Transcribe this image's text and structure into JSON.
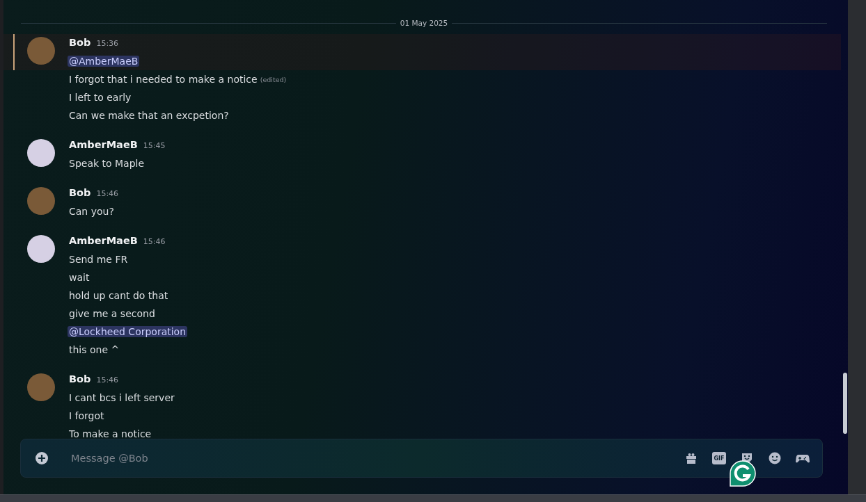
{
  "date_divider": "01 May 2025",
  "messages": [
    {
      "author": "Bob",
      "time": "15:36",
      "avatar": {
        "color": "#7a5a38"
      },
      "highlighted": true,
      "lines": [
        {
          "kind": "mention",
          "text": "@AmberMaeB"
        },
        {
          "kind": "text",
          "text": "I forgot that i needed to make a notice",
          "edited": "(edited)"
        },
        {
          "kind": "text",
          "text": "I left to early"
        },
        {
          "kind": "text",
          "text": "Can we make that an excpetion?"
        }
      ]
    },
    {
      "author": "AmberMaeB",
      "time": "15:45",
      "avatar": {
        "color": "#d6d0e4"
      },
      "highlighted": false,
      "lines": [
        {
          "kind": "text",
          "text": "Speak to Maple"
        }
      ]
    },
    {
      "author": "Bob",
      "time": "15:46",
      "avatar": {
        "color": "#7a5a38"
      },
      "highlighted": false,
      "lines": [
        {
          "kind": "text",
          "text": "Can you?"
        }
      ]
    },
    {
      "author": "AmberMaeB",
      "time": "15:46",
      "avatar": {
        "color": "#d6d0e4"
      },
      "highlighted": false,
      "lines": [
        {
          "kind": "text",
          "text": "Send me FR"
        },
        {
          "kind": "text",
          "text": "wait"
        },
        {
          "kind": "text",
          "text": "hold up cant do that"
        },
        {
          "kind": "text",
          "text": "give me a second"
        },
        {
          "kind": "mention",
          "text": "@Lockheed Corporation"
        },
        {
          "kind": "text",
          "text": "this one ^"
        }
      ]
    },
    {
      "author": "Bob",
      "time": "15:46",
      "avatar": {
        "color": "#7a5a38"
      },
      "highlighted": false,
      "lines": [
        {
          "kind": "text",
          "text": "I cant bcs i left server"
        },
        {
          "kind": "text",
          "text": "I forgot"
        },
        {
          "kind": "text",
          "text": "To make a notice"
        }
      ]
    }
  ],
  "composer": {
    "placeholder": "Message @Bob",
    "gif_label": "GIF"
  }
}
